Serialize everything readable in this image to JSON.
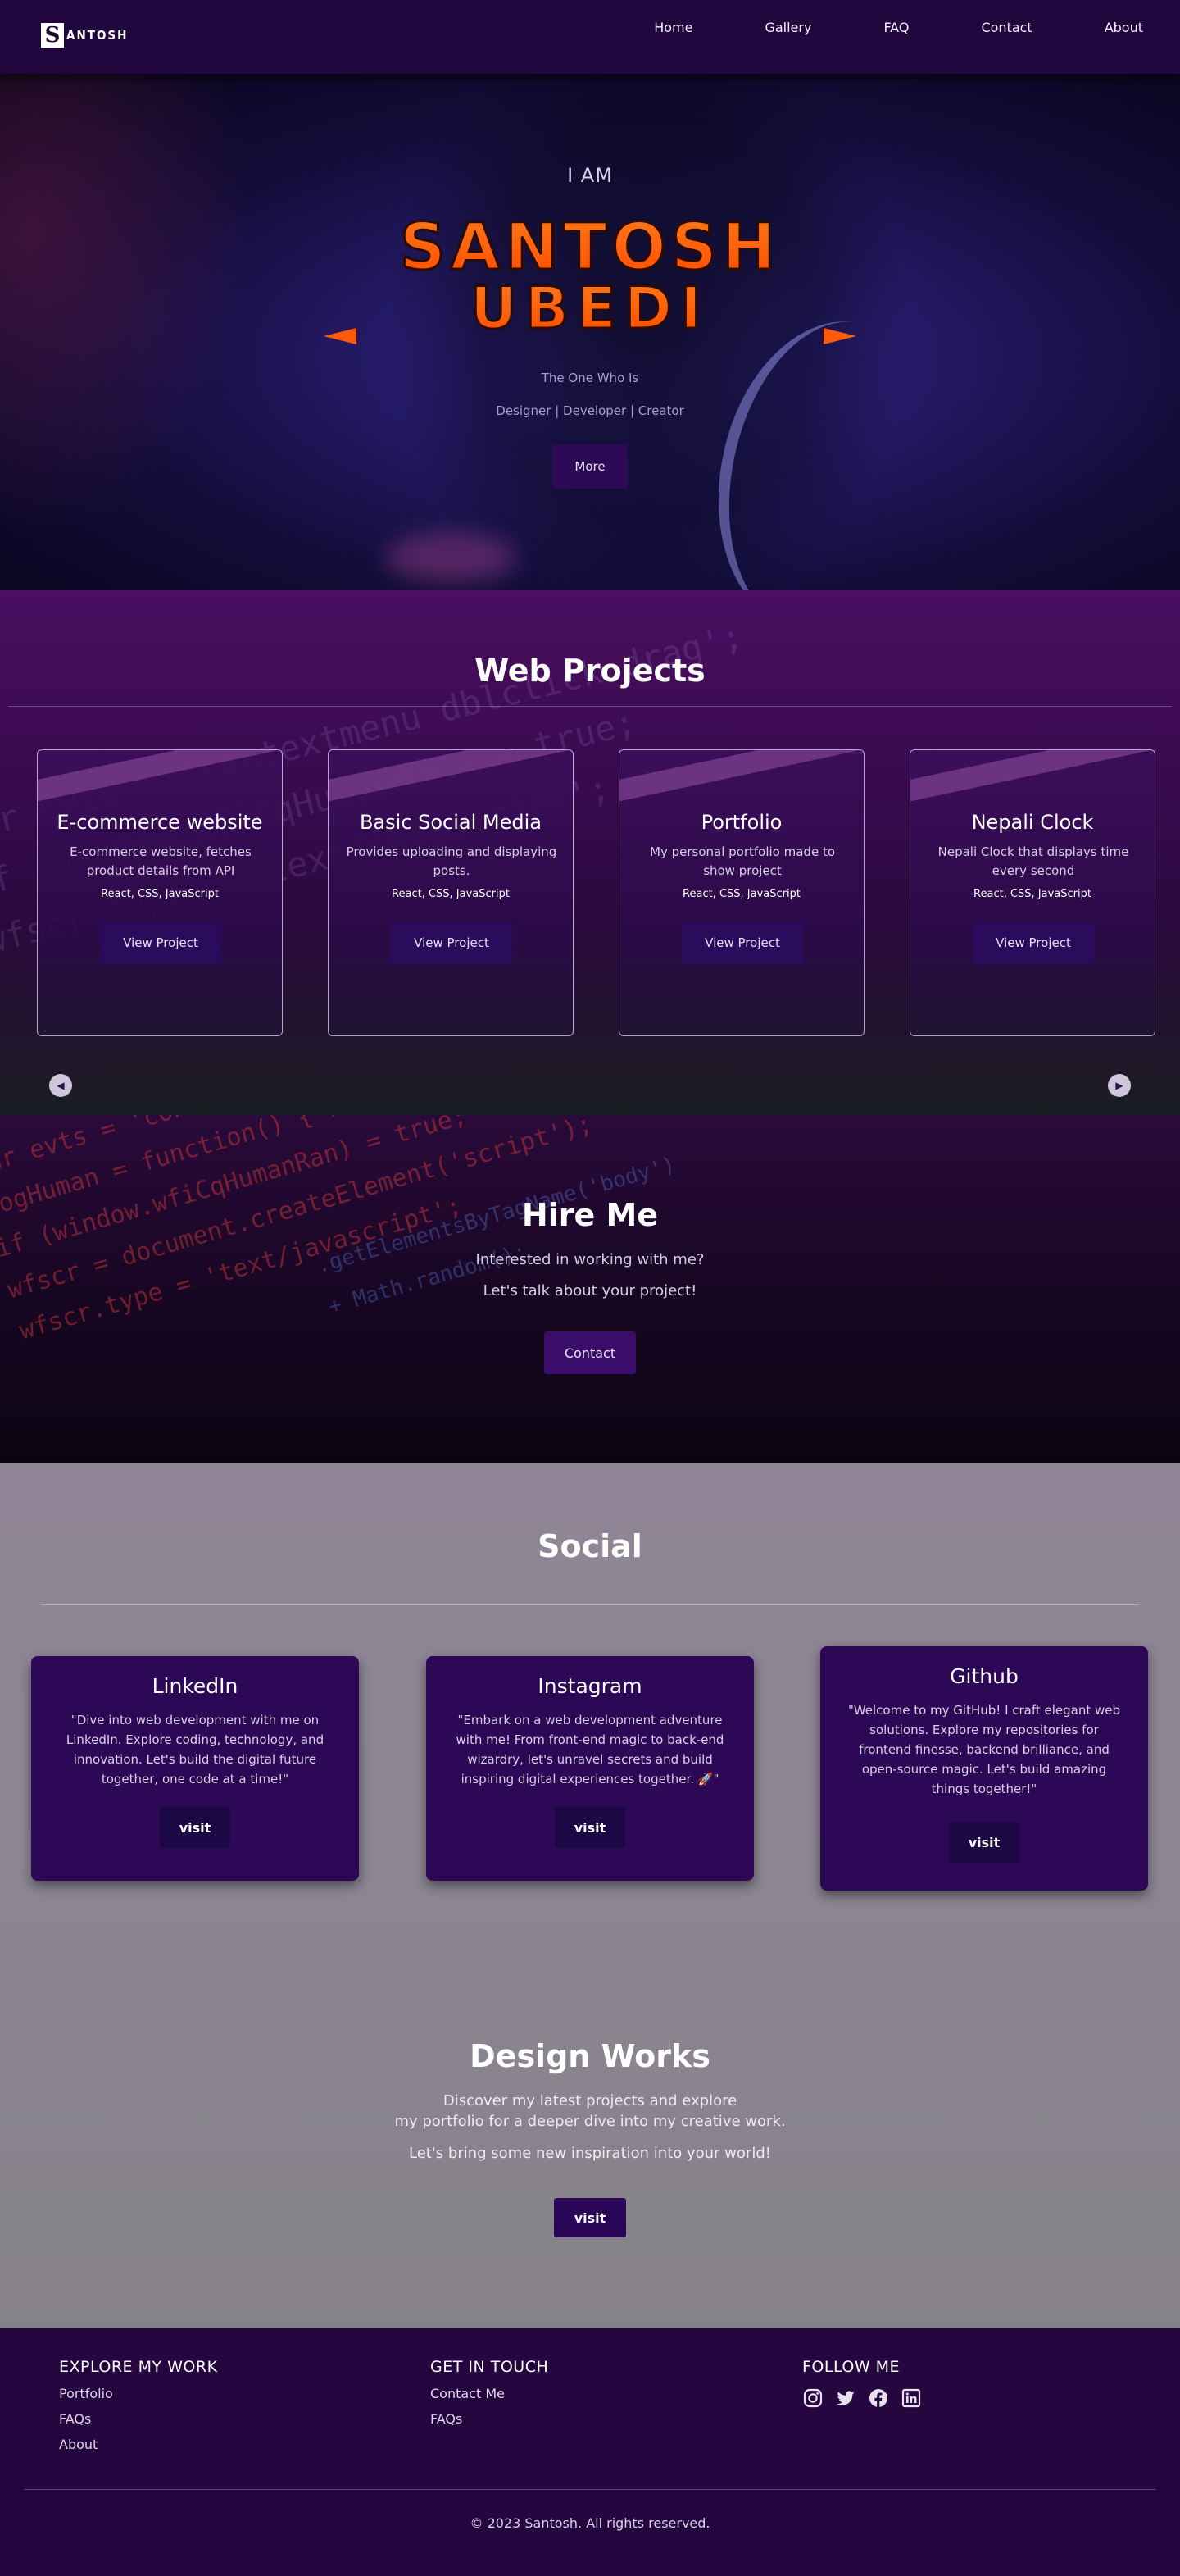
{
  "nav": {
    "logo_letter": "S",
    "logo_text": "ANTOSH",
    "links": [
      "Home",
      "Gallery",
      "FAQ",
      "Contact",
      "About"
    ]
  },
  "hero": {
    "pre_title": "I AM",
    "title_line1": "SANTOSH",
    "title_line2": "UBEDI",
    "subtitle": "The One Who Is",
    "roles": "Designer | Developer | Creator",
    "more_label": "More",
    "title_color": "#ff5a0a"
  },
  "projects": {
    "heading": "Web Projects",
    "items": [
      {
        "title": "E-commerce website",
        "desc": "E-commerce website, fetches product details from API",
        "tech": "React, CSS, JavaScript",
        "button": "View Project"
      },
      {
        "title": "Basic Social Media",
        "desc": "Provides uploading and displaying posts.",
        "tech": "React, CSS, JavaScript",
        "button": "View Project"
      },
      {
        "title": "Portfolio",
        "desc": "My personal portfolio made to show project",
        "tech": "React, CSS, JavaScript",
        "button": "View Project"
      },
      {
        "title": "Nepali Clock",
        "desc": "Nepali Clock that displays time every second",
        "tech": "React, CSS, JavaScript",
        "button": "View Project"
      }
    ]
  },
  "hire": {
    "heading": "Hire Me",
    "line1": "Interested in working with me?",
    "line2": "Let's talk about your project!",
    "button": "Contact"
  },
  "social": {
    "heading": "Social",
    "cards": [
      {
        "title": "LinkedIn",
        "text": "\"Dive into web development with me on LinkedIn. Explore coding, technology, and innovation. Let's build the digital future together, one code at a time!\"",
        "button": "visit"
      },
      {
        "title": "Instagram",
        "text": "\"Embark on a web development adventure with me! From front-end magic to back-end wizardry, let's unravel secrets and build inspiring digital experiences together. 🚀\"",
        "button": "visit"
      },
      {
        "title": "Github",
        "text": "\"Welcome to my GitHub! I craft elegant web solutions. Explore my repositories for frontend finesse, backend brilliance, and open-source magic. Let's build amazing things together!\"",
        "button": "visit"
      }
    ]
  },
  "design": {
    "heading": "Design Works",
    "line1": "Discover my latest projects and explore",
    "line2": "my portfolio for a deeper dive into my creative work.",
    "line3": "Let's bring some new inspiration into your world!",
    "button": "visit"
  },
  "footer": {
    "col1": {
      "heading": "EXPLORE MY WORK",
      "links": [
        "Portfolio",
        "FAQs",
        "About"
      ]
    },
    "col2": {
      "heading": "GET IN TOUCH",
      "links": [
        "Contact Me",
        "FAQs"
      ]
    },
    "col3": {
      "heading": "FOLLOW ME",
      "icons": [
        "instagram-icon",
        "twitter-icon",
        "facebook-icon",
        "linkedin-icon"
      ]
    },
    "copyright": "© 2023 Santosh. All rights reserved."
  }
}
